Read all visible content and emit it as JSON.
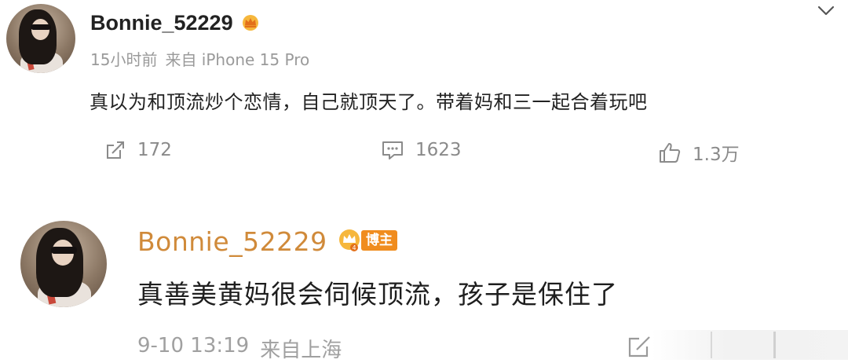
{
  "post": {
    "username": "Bonnie_52229",
    "time": "15小时前",
    "source": "来自 iPhone 15 Pro",
    "text": "真以为和顶流炒个恋情，自己就顶天了。带着妈和三一起合着玩吧",
    "actions": {
      "repost_count": "172",
      "comment_count": "1623",
      "like_count": "1.3万"
    }
  },
  "comment": {
    "username": "Bonnie_52229",
    "badge_label": "博主",
    "text": "真善美黄妈很会伺候顶流，孩子是保住了",
    "date": "9-10 13:19",
    "source": "来自上海"
  },
  "colors": {
    "accent_orange": "#f08c1e",
    "comment_username": "#d08a3a",
    "muted_gray": "#9a9a9a"
  },
  "icons": [
    "crown-icon",
    "chevron-down-icon",
    "repost-icon",
    "comment-icon",
    "like-icon",
    "blogger-badge-icon",
    "edit-icon"
  ]
}
